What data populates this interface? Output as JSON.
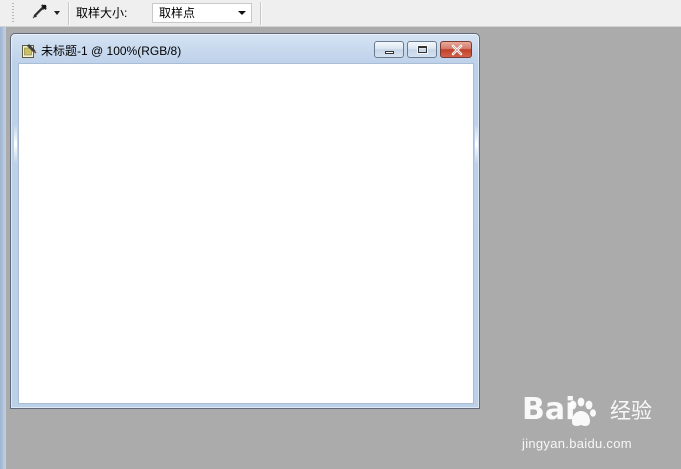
{
  "options_bar": {
    "tool_icon": "eyedropper-icon",
    "sample_size_label": "取样大小:",
    "sample_size_value": "取样点"
  },
  "document_window": {
    "title": "未标题-1 @ 100%(RGB/8)",
    "icon": "document-icon",
    "controls": {
      "minimize_icon": "minimize-icon",
      "maximize_icon": "maximize-icon",
      "close_icon": "close-icon"
    }
  },
  "watermark": {
    "logo_text_left": "Bai",
    "logo_text_right": "经验",
    "url": "jingyan.baidu.com"
  },
  "colors": {
    "workspace": "#ababab",
    "options_bar": "#efefef",
    "window_frame": "#bdd1ea",
    "canvas": "#ffffff",
    "close_button": "#c3402a"
  }
}
